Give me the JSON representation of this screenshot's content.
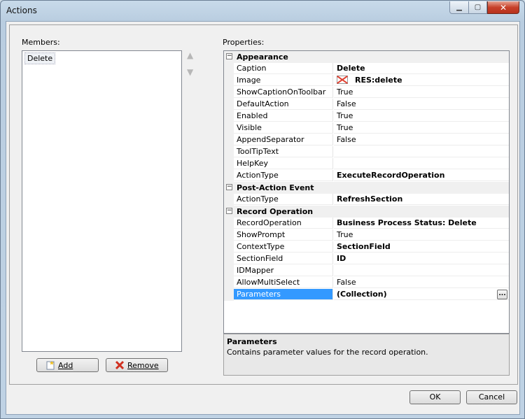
{
  "window": {
    "title": "Actions"
  },
  "members": {
    "label": "Members:",
    "items": [
      "Delete"
    ],
    "add_label": "Add",
    "remove_label": "Remove"
  },
  "properties": {
    "label": "Properties:",
    "categories": [
      {
        "name": "Appearance",
        "rows": [
          {
            "name": "Caption",
            "value": "Delete",
            "bold": true
          },
          {
            "name": "Image",
            "value": "RES:delete",
            "bold": true,
            "icon": "broken-image-icon"
          },
          {
            "name": "ShowCaptionOnToolbar",
            "value": "True"
          },
          {
            "name": "DefaultAction",
            "value": "False"
          },
          {
            "name": "Enabled",
            "value": "True"
          },
          {
            "name": "Visible",
            "value": "True"
          },
          {
            "name": "AppendSeparator",
            "value": "False"
          },
          {
            "name": "ToolTipText",
            "value": ""
          },
          {
            "name": "HelpKey",
            "value": ""
          },
          {
            "name": "ActionType",
            "value": "ExecuteRecordOperation",
            "bold": true
          }
        ]
      },
      {
        "name": "Post-Action Event",
        "rows": [
          {
            "name": "ActionType",
            "value": "RefreshSection",
            "bold": true
          }
        ]
      },
      {
        "name": "Record Operation",
        "rows": [
          {
            "name": "RecordOperation",
            "value": "Business Process Status: Delete",
            "bold": true
          },
          {
            "name": "ShowPrompt",
            "value": "True"
          },
          {
            "name": "ContextType",
            "value": "SectionField",
            "bold": true
          },
          {
            "name": "SectionField",
            "value": "ID",
            "bold": true
          },
          {
            "name": "IDMapper",
            "value": ""
          },
          {
            "name": "AllowMultiSelect",
            "value": "False"
          },
          {
            "name": "Parameters",
            "value": "(Collection)",
            "bold": true,
            "selected": true,
            "ellipsis": "..."
          }
        ]
      }
    ],
    "description": {
      "title": "Parameters",
      "text": "Contains parameter values for the record operation."
    }
  },
  "dialog": {
    "ok_label": "OK",
    "cancel_label": "Cancel"
  }
}
